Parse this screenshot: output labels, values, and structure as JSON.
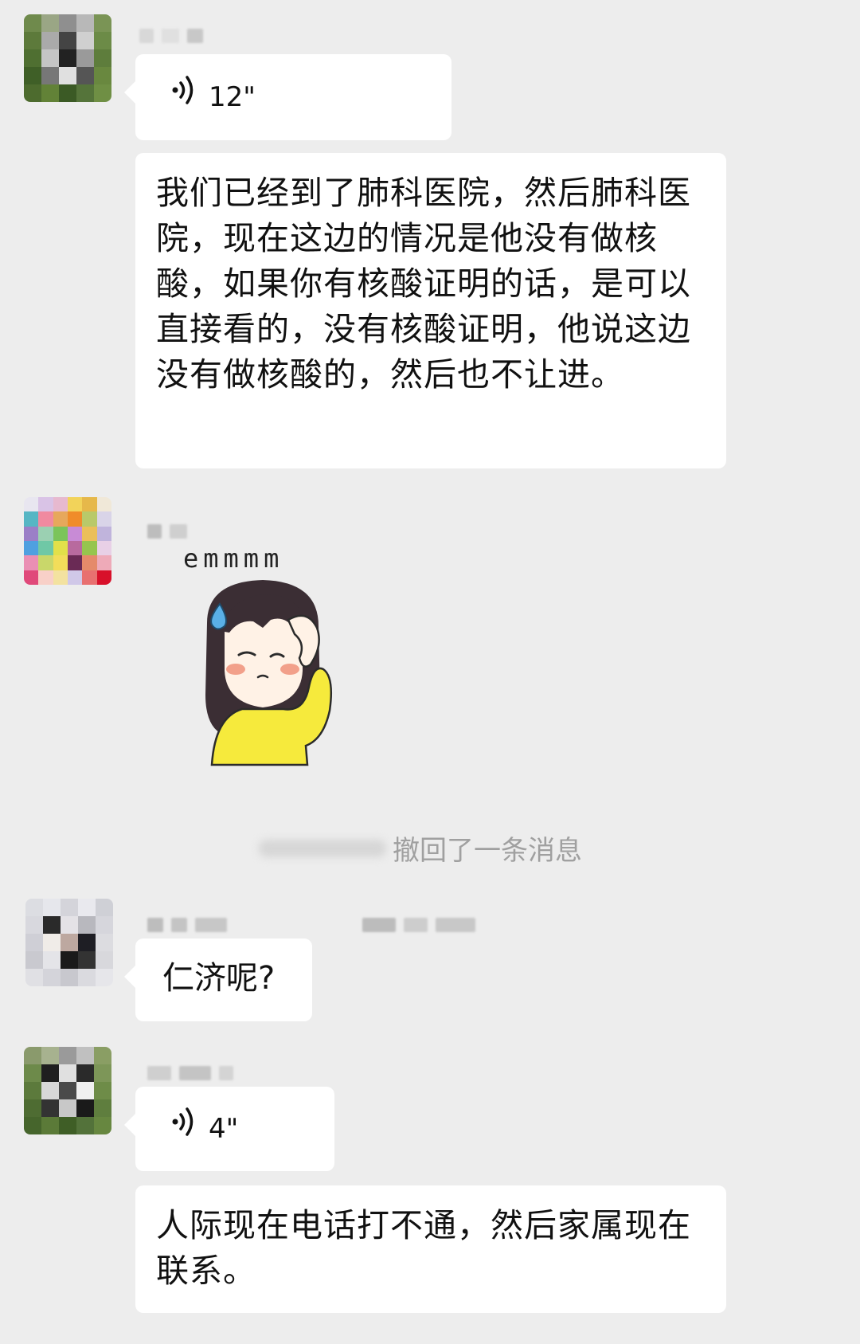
{
  "chat": {
    "messages": [
      {
        "voice_duration": "12\""
      },
      {
        "text": "我们已经到了肺科医院，然后肺科医院，现在这边的情况是他没有做核酸，如果你有核酸证明的话，是可以直接看的，没有核酸证明，他说这边没有做核酸的，然后也不让进。"
      },
      {
        "sticker_caption": "emmmm"
      },
      {
        "system_notice": "撤回了一条消息"
      },
      {
        "text": "仁济呢?"
      },
      {
        "voice_duration": "4\""
      },
      {
        "text": "人际现在电话打不通，然后家属现在联系。"
      }
    ]
  },
  "colors": {
    "background": "#ededed",
    "bubble": "#ffffff",
    "system_text": "#a0a0a0",
    "text": "#111111"
  },
  "icons": [
    "voice-wave-icon",
    "sticker-girl-image"
  ]
}
